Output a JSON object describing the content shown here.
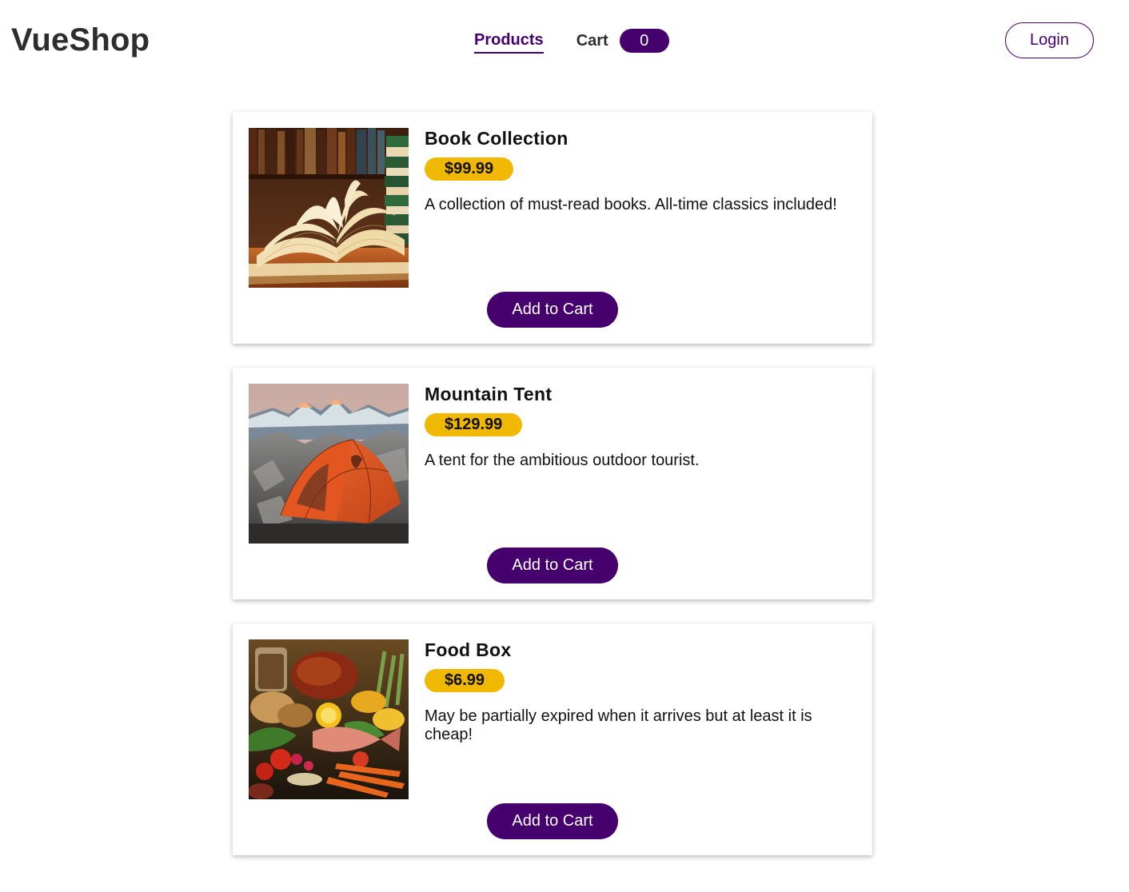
{
  "app": {
    "brand": "VueShop"
  },
  "nav": {
    "products_label": "Products",
    "cart_label": "Cart",
    "cart_count": "0",
    "login_label": "Login"
  },
  "colors": {
    "brand_purple": "#45006d",
    "price_yellow": "#f0b800"
  },
  "products": [
    {
      "title": "Book Collection",
      "price": "$99.99",
      "description": "A collection of must-read books. All-time classics included!",
      "image": "books-photo",
      "button_label": "Add to Cart"
    },
    {
      "title": "Mountain Tent",
      "price": "$129.99",
      "description": "A tent for the ambitious outdoor tourist.",
      "image": "tent-photo",
      "button_label": "Add to Cart"
    },
    {
      "title": "Food Box",
      "price": "$6.99",
      "description": "May be partially expired when it arrives but at least it is cheap!",
      "image": "food-photo",
      "button_label": "Add to Cart"
    }
  ]
}
